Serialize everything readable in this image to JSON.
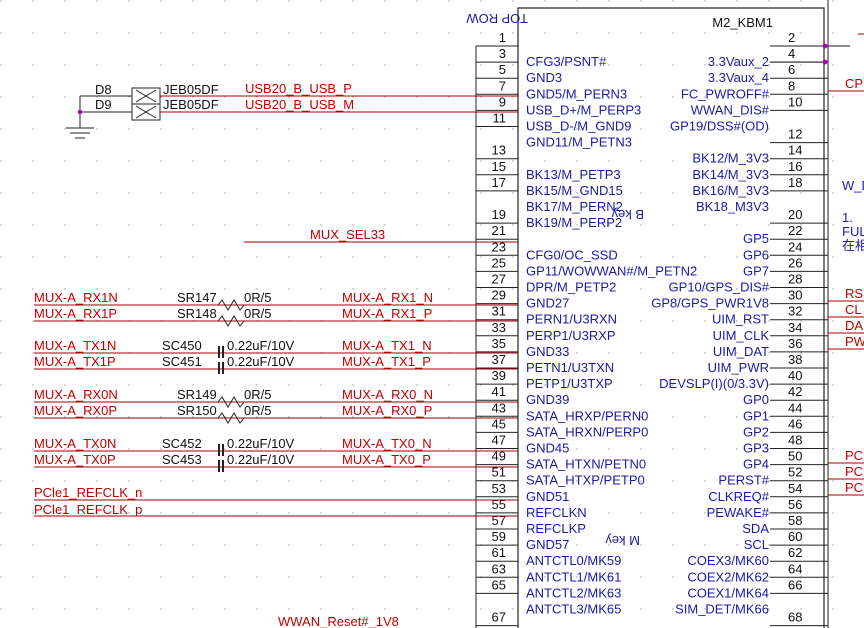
{
  "connector": {
    "ref": "M2_KBM1",
    "top_label": "TOP ROW",
    "b_key": "B key",
    "m_key": "M key"
  },
  "left_pins": [
    {
      "num": "1",
      "label": ""
    },
    {
      "num": "3",
      "label": "CFG3/PSNT#"
    },
    {
      "num": "5",
      "label": "GND3"
    },
    {
      "num": "7",
      "label": "GND5/M_PERN3"
    },
    {
      "num": "9",
      "label": "USB_D+/M_PERP3"
    },
    {
      "num": "11",
      "label": "USB_D-/M_GND9"
    },
    {
      "num": "",
      "label": "GND11/M_PETN3"
    },
    {
      "num": "13",
      "label": ""
    },
    {
      "num": "15",
      "label": "BK13/M_PETP3"
    },
    {
      "num": "17",
      "label": "BK15/M_GND15"
    },
    {
      "num": "",
      "label": "BK17/M_PERN2"
    },
    {
      "num": "19",
      "label": "BK19/M_PERP2"
    },
    {
      "num": "21",
      "label": ""
    },
    {
      "num": "23",
      "label": "CFG0/OC_SSD"
    },
    {
      "num": "25",
      "label": "GP11/WOWWAN#/M_PETN2"
    },
    {
      "num": "27",
      "label": "DPR/M_PETP2"
    },
    {
      "num": "29",
      "label": "GND27"
    },
    {
      "num": "31",
      "label": "PERN1/U3RXN"
    },
    {
      "num": "33",
      "label": "PERP1/U3RXP"
    },
    {
      "num": "35",
      "label": "GND33"
    },
    {
      "num": "37",
      "label": "PETN1/U3TXN"
    },
    {
      "num": "39",
      "label": "PETP1/U3TXP"
    },
    {
      "num": "41",
      "label": "GND39"
    },
    {
      "num": "43",
      "label": "SATA_HRXP/PERN0"
    },
    {
      "num": "45",
      "label": "SATA_HRXN/PERP0"
    },
    {
      "num": "47",
      "label": "GND45"
    },
    {
      "num": "49",
      "label": "SATA_HTXN/PETN0"
    },
    {
      "num": "51",
      "label": "SATA_HTXP/PETP0"
    },
    {
      "num": "53",
      "label": "GND51"
    },
    {
      "num": "55",
      "label": "REFCLKN"
    },
    {
      "num": "57",
      "label": "REFCLKP"
    },
    {
      "num": "59",
      "label": "GND57"
    },
    {
      "num": "61",
      "label": "ANTCTL0/MK59"
    },
    {
      "num": "63",
      "label": "ANTCTL1/MK61"
    },
    {
      "num": "65",
      "label": "ANTCTL2/MK63"
    },
    {
      "num": "",
      "label": "ANTCTL3/MK65"
    },
    {
      "num": "67",
      "label": ""
    }
  ],
  "right_pins": [
    {
      "num": "2",
      "label": ""
    },
    {
      "num": "4",
      "label": "3.3Vaux_2"
    },
    {
      "num": "6",
      "label": "3.3Vaux_4"
    },
    {
      "num": "8",
      "label": "FC_PWROFF#"
    },
    {
      "num": "10",
      "label": "WWAN_DIS#"
    },
    {
      "num": "",
      "label": "GP19/DSS#(OD)"
    },
    {
      "num": "12",
      "label": ""
    },
    {
      "num": "14",
      "label": "BK12/M_3V3"
    },
    {
      "num": "16",
      "label": "BK14/M_3V3"
    },
    {
      "num": "18",
      "label": "BK16/M_3V3"
    },
    {
      "num": "",
      "label": "BK18_M3V3"
    },
    {
      "num": "20",
      "label": ""
    },
    {
      "num": "22",
      "label": "GP5"
    },
    {
      "num": "24",
      "label": "GP6"
    },
    {
      "num": "26",
      "label": "GP7"
    },
    {
      "num": "28",
      "label": "GP10/GPS_DIS#"
    },
    {
      "num": "30",
      "label": "GP8/GPS_PWR1V8"
    },
    {
      "num": "32",
      "label": "UIM_RST"
    },
    {
      "num": "34",
      "label": "UIM_CLK"
    },
    {
      "num": "36",
      "label": "UIM_DAT"
    },
    {
      "num": "38",
      "label": "UIM_PWR"
    },
    {
      "num": "40",
      "label": "DEVSLP(I)(0/3.3V)"
    },
    {
      "num": "42",
      "label": "GP0"
    },
    {
      "num": "44",
      "label": "GP1"
    },
    {
      "num": "46",
      "label": "GP2"
    },
    {
      "num": "48",
      "label": "GP3"
    },
    {
      "num": "50",
      "label": "GP4"
    },
    {
      "num": "52",
      "label": "PERST#"
    },
    {
      "num": "54",
      "label": "CLKREQ#"
    },
    {
      "num": "56",
      "label": "PEWAKE#"
    },
    {
      "num": "58",
      "label": "SDA"
    },
    {
      "num": "60",
      "label": "SCL"
    },
    {
      "num": "62",
      "label": "COEX3/MK60"
    },
    {
      "num": "64",
      "label": "COEX2/MK62"
    },
    {
      "num": "66",
      "label": "COEX1/MK64"
    },
    {
      "num": "",
      "label": "SIM_DET/MK66"
    },
    {
      "num": "68",
      "label": ""
    }
  ],
  "diodes": {
    "d8": {
      "ref": "D8",
      "part": "JEB05DF"
    },
    "d9": {
      "ref": "D9",
      "part": "JEB05DF"
    },
    "usb_p": "USB20_B_USB_P",
    "usb_m": "USB20_B_USB_M"
  },
  "mux_sel": "MUX_SEL33",
  "groups": [
    {
      "left": "MUX-A_RX1N",
      "ref": "SR147",
      "value": "0R/5",
      "right": "MUX-A_RX1_N"
    },
    {
      "left": "MUX-A_RX1P",
      "ref": "SR148",
      "value": "0R/5",
      "right": "MUX-A_RX1_P"
    },
    {
      "left": "MUX-A_TX1N",
      "ref": "SC450",
      "value": "0.22uF/10V",
      "right": "MUX-A_TX1_N"
    },
    {
      "left": "MUX-A_TX1P",
      "ref": "SC451",
      "value": "0.22uF/10V",
      "right": "MUX-A_TX1_P"
    },
    {
      "left": "MUX-A_RX0N",
      "ref": "SR149",
      "value": "0R/5",
      "right": "MUX-A_RX0_N"
    },
    {
      "left": "MUX-A_RX0P",
      "ref": "SR150",
      "value": "0R/5",
      "right": "MUX-A_RX0_P"
    },
    {
      "left": "MUX-A_TX0N",
      "ref": "SC452",
      "value": "0.22uF/10V",
      "right": "MUX-A_TX0_N"
    },
    {
      "left": "MUX-A_TX0P",
      "ref": "SC453",
      "value": "0.22uF/10V",
      "right": "MUX-A_TX0_P"
    }
  ],
  "refclk": {
    "n": "PCle1_REFCLK_n",
    "p": "PCle1_REFCLK_p"
  },
  "bottom_net": "WWAN_Reset#_1V8",
  "right_nets": [
    "CP",
    "RS",
    "CL",
    "DA",
    "PW",
    "PC",
    "PC",
    "PC"
  ],
  "note": {
    "l1": "W_D",
    "l2": "1.",
    "l3": "FUL",
    "l4": "在相"
  }
}
